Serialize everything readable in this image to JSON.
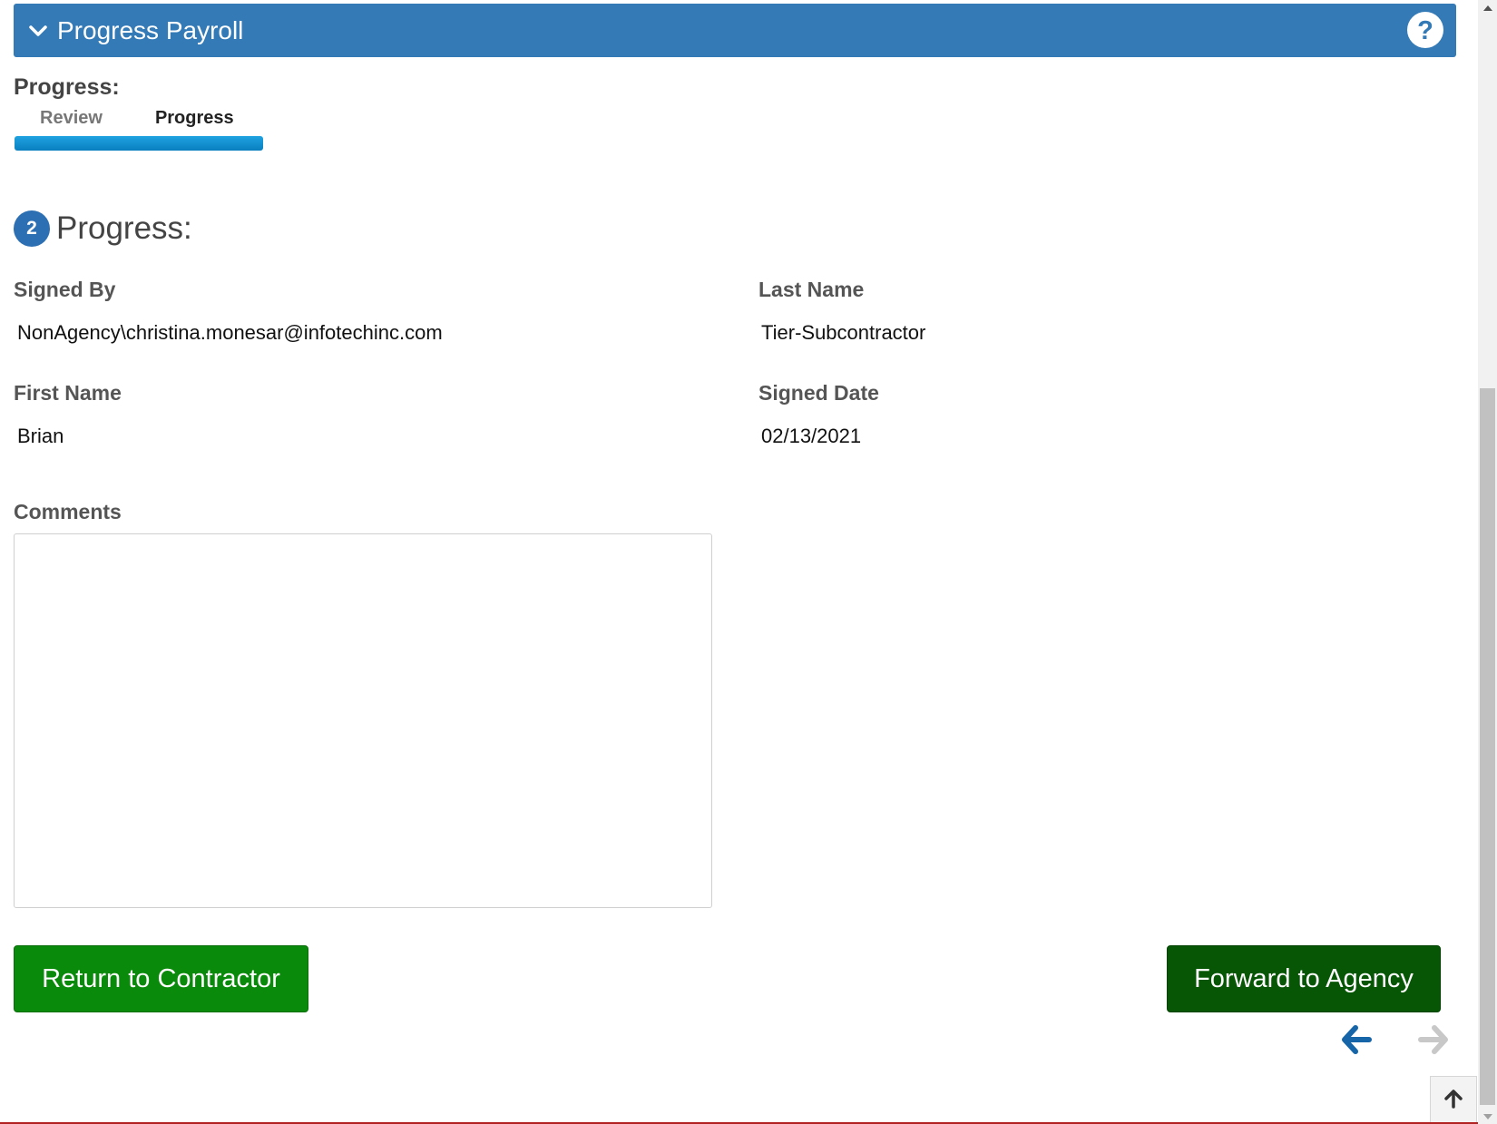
{
  "header": {
    "title": "Progress Payroll",
    "color": "#337ab7"
  },
  "wizard": {
    "label": "Progress:",
    "steps": [
      {
        "label": "Review",
        "state": "inactive"
      },
      {
        "label": "Progress",
        "state": "active"
      }
    ],
    "bar_color": "#0a8fd0"
  },
  "section": {
    "step_number": "2",
    "title": "Progress:"
  },
  "fields": {
    "signed_by": {
      "label": "Signed By",
      "value": "NonAgency\\christina.monesar@infotechinc.com"
    },
    "last_name": {
      "label": "Last Name",
      "value": "Tier-Subcontractor"
    },
    "first_name": {
      "label": "First Name",
      "value": "Brian"
    },
    "signed_date": {
      "label": "Signed Date",
      "value": "02/13/2021"
    }
  },
  "comments": {
    "label": "Comments",
    "value": ""
  },
  "buttons": {
    "return_label": "Return to Contractor",
    "forward_label": "Forward to Agency"
  },
  "icons": {
    "collapse": "chevron-down-icon",
    "help": "question-circle-icon",
    "prev": "arrow-left-icon",
    "next": "arrow-right-icon",
    "back_to_top": "arrow-up-icon"
  },
  "colors": {
    "return_button": "#0a8a0a",
    "forward_button": "#065606",
    "nav_active": "#1565a8",
    "nav_disabled": "#c8c8c8"
  }
}
